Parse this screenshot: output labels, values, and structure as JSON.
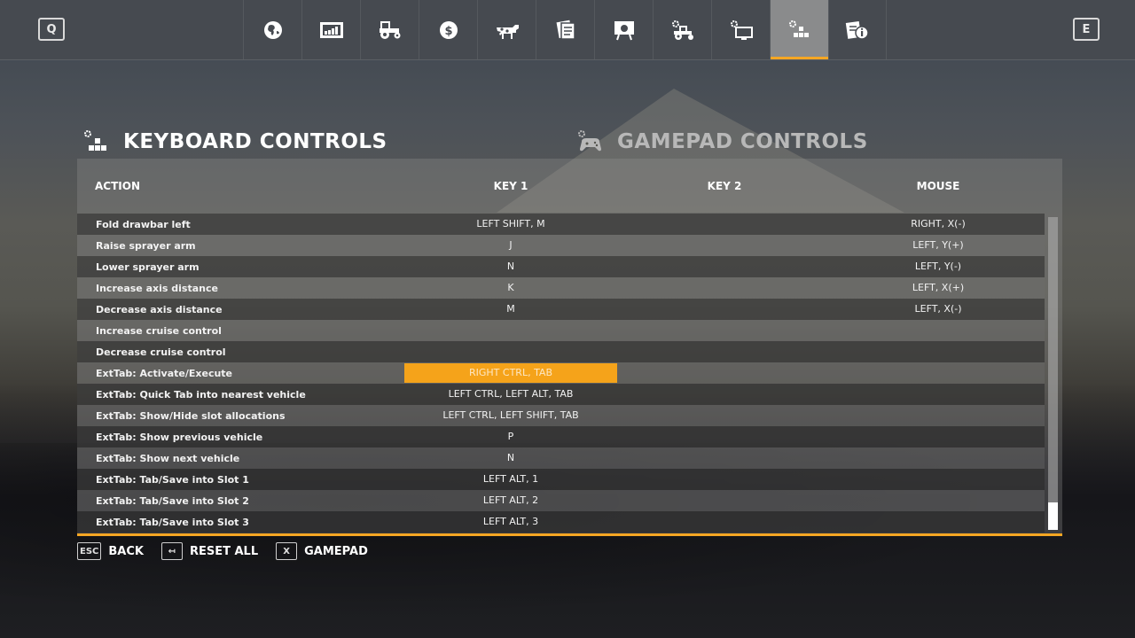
{
  "topbar": {
    "prev_key": "Q",
    "next_key": "E",
    "tabs": [
      {
        "icon": "globe-map-icon",
        "active": false
      },
      {
        "icon": "statistics-chart-icon",
        "active": false
      },
      {
        "icon": "tractor-icon",
        "active": false
      },
      {
        "icon": "dollar-finance-icon",
        "active": false
      },
      {
        "icon": "cow-animals-icon",
        "active": false
      },
      {
        "icon": "contracts-documents-icon",
        "active": false
      },
      {
        "icon": "presentation-board-icon",
        "active": false
      },
      {
        "icon": "vehicle-settings-icon",
        "active": false
      },
      {
        "icon": "display-settings-icon",
        "active": false
      },
      {
        "icon": "controls-settings-icon",
        "active": true
      },
      {
        "icon": "help-info-icon",
        "active": false
      }
    ],
    "accent_color": "#f5a623"
  },
  "sections": {
    "keyboard_title": "KEYBOARD CONTROLS",
    "gamepad_title": "GAMEPAD CONTROLS"
  },
  "table": {
    "headers": {
      "action": "ACTION",
      "key1": "KEY 1",
      "key2": "KEY 2",
      "mouse": "MOUSE"
    },
    "rows": [
      {
        "action": "Fold drawbar left",
        "key1": "LEFT SHIFT, M",
        "key2": "",
        "mouse": "RIGHT, X(-)"
      },
      {
        "action": "Raise sprayer arm",
        "key1": "J",
        "key2": "",
        "mouse": "LEFT, Y(+)"
      },
      {
        "action": "Lower sprayer arm",
        "key1": "N",
        "key2": "",
        "mouse": "LEFT, Y(-)"
      },
      {
        "action": "Increase axis distance",
        "key1": "K",
        "key2": "",
        "mouse": "LEFT, X(+)"
      },
      {
        "action": "Decrease axis distance",
        "key1": "M",
        "key2": "",
        "mouse": "LEFT, X(-)"
      },
      {
        "action": "Increase cruise control",
        "key1": "",
        "key2": "",
        "mouse": ""
      },
      {
        "action": "Decrease cruise control",
        "key1": "",
        "key2": "",
        "mouse": ""
      },
      {
        "action": "ExtTab: Activate/Execute",
        "key1": "RIGHT CTRL, TAB",
        "key2": "",
        "mouse": "",
        "selected": true
      },
      {
        "action": "ExtTab: Quick Tab into nearest vehicle",
        "key1": "LEFT CTRL, LEFT ALT, TAB",
        "key2": "",
        "mouse": ""
      },
      {
        "action": "ExtTab: Show/Hide slot allocations",
        "key1": "LEFT CTRL, LEFT SHIFT, TAB",
        "key2": "",
        "mouse": ""
      },
      {
        "action": "ExtTab: Show previous vehicle",
        "key1": "P",
        "key2": "",
        "mouse": ""
      },
      {
        "action": "ExtTab: Show next vehicle",
        "key1": "N",
        "key2": "",
        "mouse": ""
      },
      {
        "action": "ExtTab: Tab/Save into Slot 1",
        "key1": "LEFT ALT, 1",
        "key2": "",
        "mouse": ""
      },
      {
        "action": "ExtTab: Tab/Save into Slot 2",
        "key1": "LEFT ALT, 2",
        "key2": "",
        "mouse": ""
      },
      {
        "action": "ExtTab: Tab/Save into Slot 3",
        "key1": "LEFT ALT, 3",
        "key2": "",
        "mouse": ""
      }
    ],
    "scroll_position": 1.0
  },
  "footer": {
    "back": {
      "key": "ESC",
      "label": "BACK"
    },
    "reset": {
      "key": "↤",
      "label": "RESET ALL"
    },
    "gamepad": {
      "key": "X",
      "label": "GAMEPAD"
    }
  }
}
